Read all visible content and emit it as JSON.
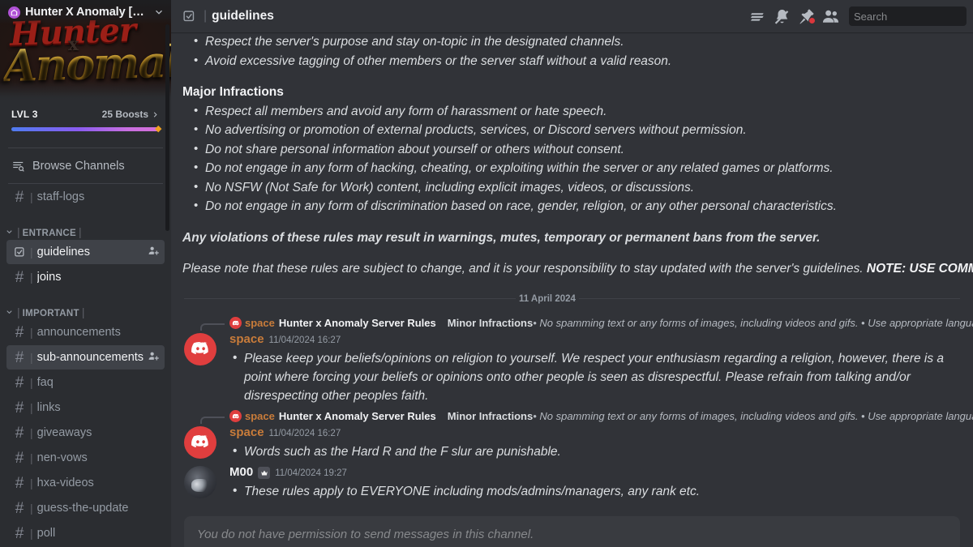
{
  "sidebar": {
    "server_name": "Hunter X Anomaly [B...",
    "banner_word_1": "Hunter",
    "banner_word_x": "x",
    "banner_word_2": "Anomaly",
    "boost": {
      "level_label": "LVL 3",
      "count_label": "25 Boosts"
    },
    "browse_channels_label": "Browse Channels",
    "groups": [
      {
        "category": null,
        "channels": [
          {
            "name": "staff-logs",
            "icon": "hash-icon",
            "state": "normal",
            "invite": false
          }
        ]
      },
      {
        "category": "ENTRANCE",
        "channels": [
          {
            "name": "guidelines",
            "icon": "rules-channel-icon",
            "state": "active",
            "invite": true
          },
          {
            "name": "joins",
            "icon": "hash-icon",
            "state": "unread",
            "invite": false
          }
        ]
      },
      {
        "category": "IMPORTANT",
        "channels": [
          {
            "name": "announcements",
            "icon": "hash-icon",
            "state": "normal",
            "invite": false
          },
          {
            "name": "sub-announcements",
            "icon": "hash-icon",
            "state": "hover",
            "invite": true
          },
          {
            "name": "faq",
            "icon": "hash-icon",
            "state": "normal",
            "invite": false
          },
          {
            "name": "links",
            "icon": "hash-icon",
            "state": "normal",
            "invite": false
          },
          {
            "name": "giveaways",
            "icon": "hash-icon",
            "state": "normal",
            "invite": false
          },
          {
            "name": "nen-vows",
            "icon": "hash-icon",
            "state": "normal",
            "invite": false
          },
          {
            "name": "hxa-videos",
            "icon": "hash-icon",
            "state": "normal",
            "invite": false
          },
          {
            "name": "guess-the-update",
            "icon": "hash-icon",
            "state": "normal",
            "invite": false
          },
          {
            "name": "poll",
            "icon": "hash-icon",
            "state": "normal",
            "invite": false
          }
        ]
      }
    ]
  },
  "topbar": {
    "channel_name": "guidelines",
    "icons": [
      "threads-icon",
      "notification-muted-icon",
      "pinned-messages-icon",
      "member-list-icon"
    ],
    "search_placeholder": "Search"
  },
  "document": {
    "minor_bullets_visible": [
      "Respect the server's purpose and stay on-topic in the designated channels.",
      "Avoid excessive tagging of other members or the server staff without a valid reason."
    ],
    "major_heading": "Major Infractions",
    "major_bullets": [
      "Respect all members and avoid any form of harassment or hate speech.",
      "No advertising or promotion of external products, services, or Discord servers without permission.",
      "Do not share personal information about yourself or others without consent.",
      "Do not engage in any form of hacking, cheating, or exploiting within the server or any related games or platforms.",
      "No NSFW (Not Safe for Work) content, including explicit images, videos, or discussions.",
      "Do not engage in any form of discrimination based on race, gender, religion, or any other personal characteristics."
    ],
    "warning_line": "Any violations of these rules may result in warnings, mutes, temporary or permanent bans from the server.",
    "closing_line": "Please note that these rules are subject to change, and it is your responsibility to stay updated with the server's guidelines. ",
    "closing_note": "NOTE: USE COMMON SENS"
  },
  "date_divider": "11 April 2024",
  "messages": [
    {
      "reply": {
        "bot_tag": "space",
        "author": "Hunter x Anomaly Server Rules",
        "preview_bold": "Minor Infractions",
        "preview_text": " • No spamming text or any forms of images, including videos and gifs.  • Use appropriate language and keep disc"
      },
      "author": "space",
      "author_color": "#c97c3a",
      "timestamp": "11/04/2024 16:27",
      "avatar": "discord-logo-avatar",
      "crown": false,
      "bullets": [
        "Please keep your beliefs/opinions on religion to yourself. We respect your enthusiasm regarding a religion, however, there is a point where forcing your beliefs or opinions onto other people is seen as disrespectful. Please refrain from talking and/or disrespecting other peoples faith."
      ]
    },
    {
      "reply": {
        "bot_tag": "space",
        "author": "Hunter x Anomaly Server Rules",
        "preview_bold": "Minor Infractions",
        "preview_text": " • No spamming text or any forms of images, including videos and gifs.  • Use appropriate language and keep disc"
      },
      "author": "space",
      "author_color": "#c97c3a",
      "timestamp": "11/04/2024 16:27",
      "avatar": "discord-logo-avatar",
      "crown": false,
      "bullets": [
        "Words such as the Hard R and the F slur are punishable."
      ]
    },
    {
      "reply": null,
      "author": "M00",
      "author_color": "#f2f3f5",
      "timestamp": "11/04/2024 19:27",
      "avatar": "user-photo-avatar",
      "crown": true,
      "bullets": [
        "These rules apply to EVERYONE including mods/admins/managers, any rank etc."
      ]
    }
  ],
  "composer": {
    "no_permission_text": "You do not have permission to send messages in this channel."
  }
}
